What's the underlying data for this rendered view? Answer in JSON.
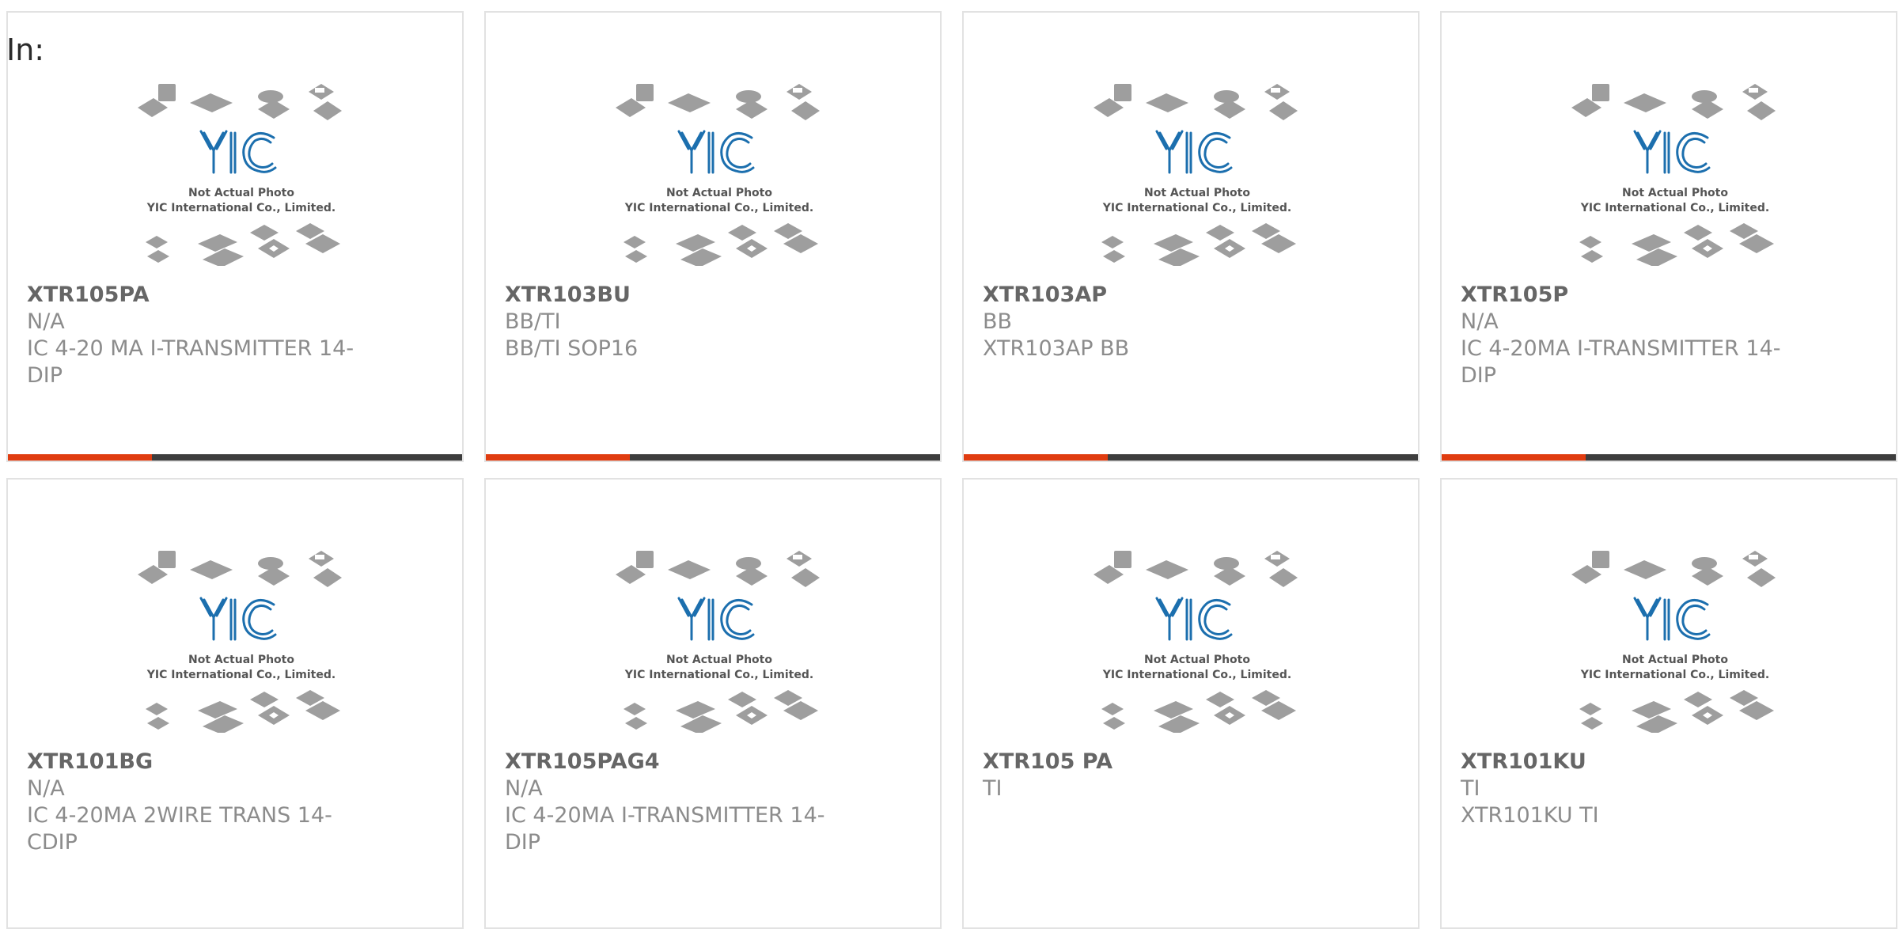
{
  "page": {
    "in_label": "In:"
  },
  "theme": {
    "accent": "#e03c10",
    "bar": "#3d3d3d"
  },
  "photo": {
    "logo": "YIC",
    "caption_line1": "Not Actual Photo",
    "caption_line2": "YIC International Co., Limited."
  },
  "products": [
    {
      "part_number": "XTR105PA",
      "manufacturer": "N/A",
      "description": "IC 4-20 MA I-TRANSMITTER 14-DIP",
      "bar": true
    },
    {
      "part_number": "XTR103BU",
      "manufacturer": "BB/TI",
      "description": "BB/TI SOP16",
      "bar": true
    },
    {
      "part_number": "XTR103AP",
      "manufacturer": "BB",
      "description": "XTR103AP BB",
      "bar": true
    },
    {
      "part_number": "XTR105P",
      "manufacturer": "N/A",
      "description": "IC 4-20MA I-TRANSMITTER 14-DIP",
      "bar": true
    },
    {
      "part_number": "XTR101BG",
      "manufacturer": "N/A",
      "description": "IC 4-20MA 2WIRE TRANS 14-CDIP",
      "bar": false
    },
    {
      "part_number": "XTR105PAG4",
      "manufacturer": "N/A",
      "description": "IC 4-20MA I-TRANSMITTER 14-DIP",
      "bar": false
    },
    {
      "part_number": "XTR105 PA",
      "manufacturer": "TI",
      "description": "",
      "bar": false
    },
    {
      "part_number": "XTR101KU",
      "manufacturer": "TI",
      "description": "XTR101KU TI",
      "bar": false
    }
  ]
}
